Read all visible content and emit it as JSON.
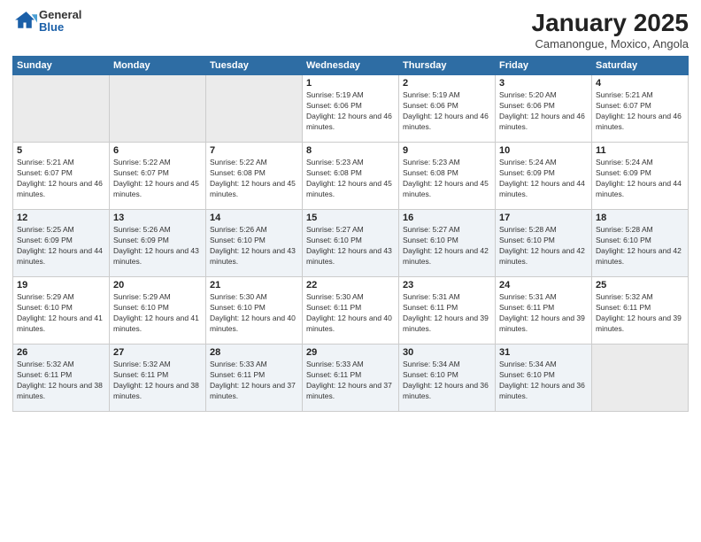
{
  "header": {
    "logo_general": "General",
    "logo_blue": "Blue",
    "month_title": "January 2025",
    "location": "Camanongue, Moxico, Angola"
  },
  "weekdays": [
    "Sunday",
    "Monday",
    "Tuesday",
    "Wednesday",
    "Thursday",
    "Friday",
    "Saturday"
  ],
  "weeks": [
    [
      {
        "day": "",
        "empty": true
      },
      {
        "day": "",
        "empty": true
      },
      {
        "day": "",
        "empty": true
      },
      {
        "day": "1",
        "sunrise": "Sunrise: 5:19 AM",
        "sunset": "Sunset: 6:06 PM",
        "daylight": "Daylight: 12 hours and 46 minutes."
      },
      {
        "day": "2",
        "sunrise": "Sunrise: 5:19 AM",
        "sunset": "Sunset: 6:06 PM",
        "daylight": "Daylight: 12 hours and 46 minutes."
      },
      {
        "day": "3",
        "sunrise": "Sunrise: 5:20 AM",
        "sunset": "Sunset: 6:06 PM",
        "daylight": "Daylight: 12 hours and 46 minutes."
      },
      {
        "day": "4",
        "sunrise": "Sunrise: 5:21 AM",
        "sunset": "Sunset: 6:07 PM",
        "daylight": "Daylight: 12 hours and 46 minutes."
      }
    ],
    [
      {
        "day": "5",
        "sunrise": "Sunrise: 5:21 AM",
        "sunset": "Sunset: 6:07 PM",
        "daylight": "Daylight: 12 hours and 46 minutes."
      },
      {
        "day": "6",
        "sunrise": "Sunrise: 5:22 AM",
        "sunset": "Sunset: 6:07 PM",
        "daylight": "Daylight: 12 hours and 45 minutes."
      },
      {
        "day": "7",
        "sunrise": "Sunrise: 5:22 AM",
        "sunset": "Sunset: 6:08 PM",
        "daylight": "Daylight: 12 hours and 45 minutes."
      },
      {
        "day": "8",
        "sunrise": "Sunrise: 5:23 AM",
        "sunset": "Sunset: 6:08 PM",
        "daylight": "Daylight: 12 hours and 45 minutes."
      },
      {
        "day": "9",
        "sunrise": "Sunrise: 5:23 AM",
        "sunset": "Sunset: 6:08 PM",
        "daylight": "Daylight: 12 hours and 45 minutes."
      },
      {
        "day": "10",
        "sunrise": "Sunrise: 5:24 AM",
        "sunset": "Sunset: 6:09 PM",
        "daylight": "Daylight: 12 hours and 44 minutes."
      },
      {
        "day": "11",
        "sunrise": "Sunrise: 5:24 AM",
        "sunset": "Sunset: 6:09 PM",
        "daylight": "Daylight: 12 hours and 44 minutes."
      }
    ],
    [
      {
        "day": "12",
        "sunrise": "Sunrise: 5:25 AM",
        "sunset": "Sunset: 6:09 PM",
        "daylight": "Daylight: 12 hours and 44 minutes."
      },
      {
        "day": "13",
        "sunrise": "Sunrise: 5:26 AM",
        "sunset": "Sunset: 6:09 PM",
        "daylight": "Daylight: 12 hours and 43 minutes."
      },
      {
        "day": "14",
        "sunrise": "Sunrise: 5:26 AM",
        "sunset": "Sunset: 6:10 PM",
        "daylight": "Daylight: 12 hours and 43 minutes."
      },
      {
        "day": "15",
        "sunrise": "Sunrise: 5:27 AM",
        "sunset": "Sunset: 6:10 PM",
        "daylight": "Daylight: 12 hours and 43 minutes."
      },
      {
        "day": "16",
        "sunrise": "Sunrise: 5:27 AM",
        "sunset": "Sunset: 6:10 PM",
        "daylight": "Daylight: 12 hours and 42 minutes."
      },
      {
        "day": "17",
        "sunrise": "Sunrise: 5:28 AM",
        "sunset": "Sunset: 6:10 PM",
        "daylight": "Daylight: 12 hours and 42 minutes."
      },
      {
        "day": "18",
        "sunrise": "Sunrise: 5:28 AM",
        "sunset": "Sunset: 6:10 PM",
        "daylight": "Daylight: 12 hours and 42 minutes."
      }
    ],
    [
      {
        "day": "19",
        "sunrise": "Sunrise: 5:29 AM",
        "sunset": "Sunset: 6:10 PM",
        "daylight": "Daylight: 12 hours and 41 minutes."
      },
      {
        "day": "20",
        "sunrise": "Sunrise: 5:29 AM",
        "sunset": "Sunset: 6:10 PM",
        "daylight": "Daylight: 12 hours and 41 minutes."
      },
      {
        "day": "21",
        "sunrise": "Sunrise: 5:30 AM",
        "sunset": "Sunset: 6:10 PM",
        "daylight": "Daylight: 12 hours and 40 minutes."
      },
      {
        "day": "22",
        "sunrise": "Sunrise: 5:30 AM",
        "sunset": "Sunset: 6:11 PM",
        "daylight": "Daylight: 12 hours and 40 minutes."
      },
      {
        "day": "23",
        "sunrise": "Sunrise: 5:31 AM",
        "sunset": "Sunset: 6:11 PM",
        "daylight": "Daylight: 12 hours and 39 minutes."
      },
      {
        "day": "24",
        "sunrise": "Sunrise: 5:31 AM",
        "sunset": "Sunset: 6:11 PM",
        "daylight": "Daylight: 12 hours and 39 minutes."
      },
      {
        "day": "25",
        "sunrise": "Sunrise: 5:32 AM",
        "sunset": "Sunset: 6:11 PM",
        "daylight": "Daylight: 12 hours and 39 minutes."
      }
    ],
    [
      {
        "day": "26",
        "sunrise": "Sunrise: 5:32 AM",
        "sunset": "Sunset: 6:11 PM",
        "daylight": "Daylight: 12 hours and 38 minutes."
      },
      {
        "day": "27",
        "sunrise": "Sunrise: 5:32 AM",
        "sunset": "Sunset: 6:11 PM",
        "daylight": "Daylight: 12 hours and 38 minutes."
      },
      {
        "day": "28",
        "sunrise": "Sunrise: 5:33 AM",
        "sunset": "Sunset: 6:11 PM",
        "daylight": "Daylight: 12 hours and 37 minutes."
      },
      {
        "day": "29",
        "sunrise": "Sunrise: 5:33 AM",
        "sunset": "Sunset: 6:11 PM",
        "daylight": "Daylight: 12 hours and 37 minutes."
      },
      {
        "day": "30",
        "sunrise": "Sunrise: 5:34 AM",
        "sunset": "Sunset: 6:10 PM",
        "daylight": "Daylight: 12 hours and 36 minutes."
      },
      {
        "day": "31",
        "sunrise": "Sunrise: 5:34 AM",
        "sunset": "Sunset: 6:10 PM",
        "daylight": "Daylight: 12 hours and 36 minutes."
      },
      {
        "day": "",
        "empty": true
      }
    ]
  ]
}
